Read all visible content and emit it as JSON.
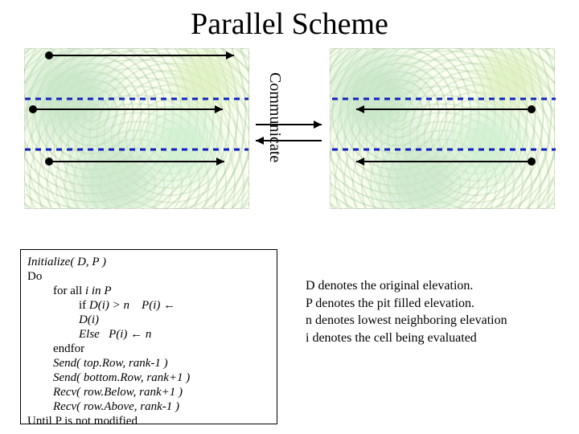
{
  "title": "Parallel Scheme",
  "communicate_label": "Communicate",
  "algorithm": {
    "l0": "Initialize( D, P )",
    "l1": "Do",
    "l2": "for all i in P",
    "l3": "if D(i) > n    P(i) ←",
    "l3b": "D(i)",
    "l4": "Else   P(i) ← n",
    "l5": "endfor",
    "l6": "Send( top.Row, rank-1 )",
    "l7": "Send( bottom.Row, rank+1 )",
    "l8": "Recv( row.Below, rank+1 )",
    "l9": "Recv( row.Above, rank-1 )",
    "l10": "Until P is not modified"
  },
  "legend": {
    "d": "D denotes the original elevation.",
    "p": "P denotes the pit filled elevation.",
    "n": "n denotes lowest neighboring elevation",
    "i": "i denotes the cell being evaluated"
  }
}
